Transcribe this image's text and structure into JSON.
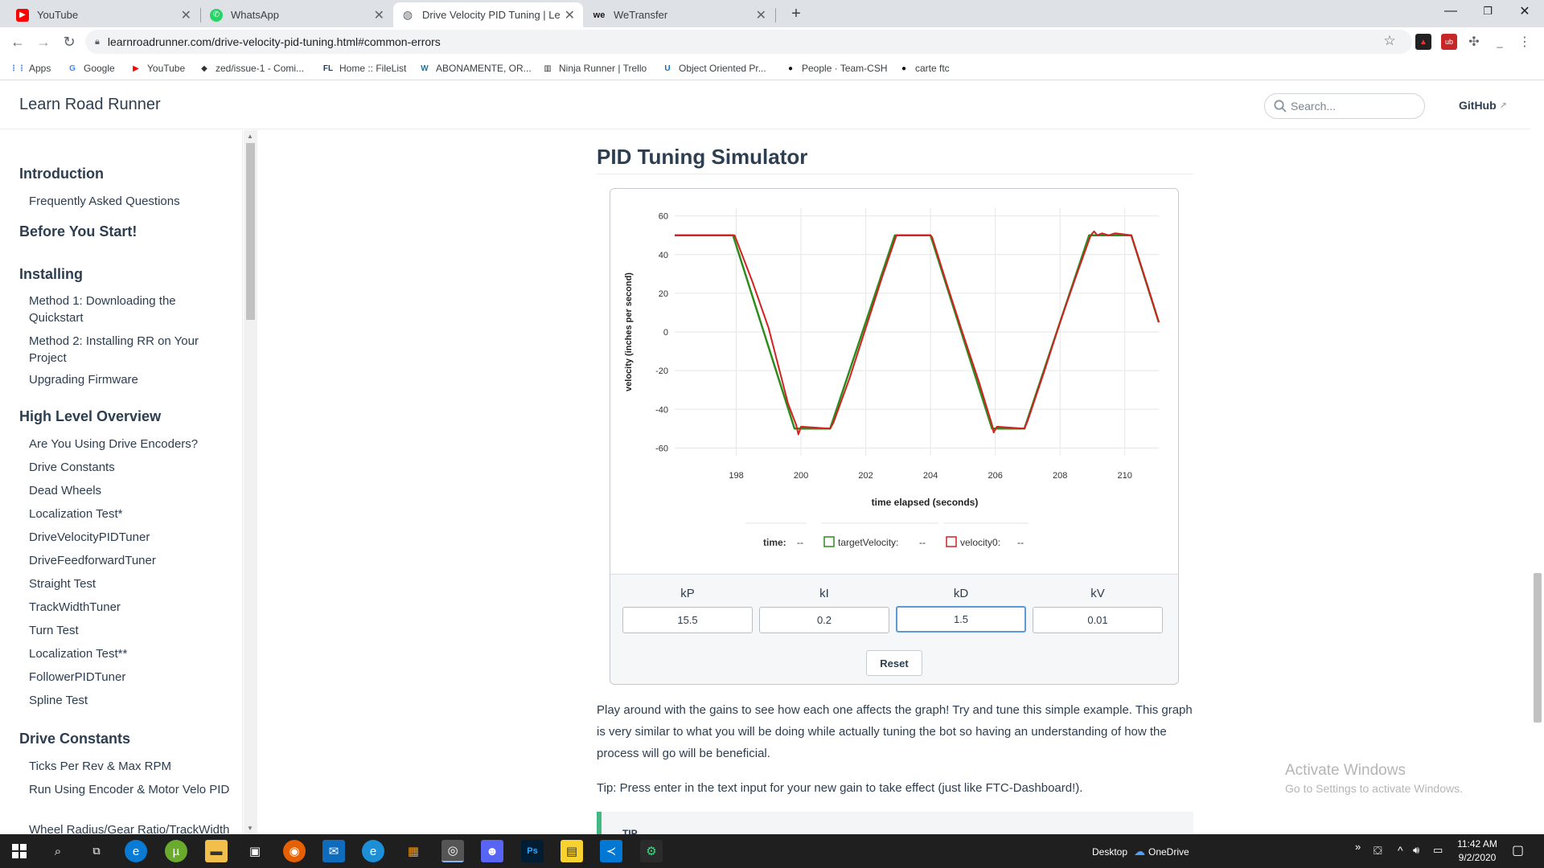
{
  "browser": {
    "tabs": [
      {
        "title": "YouTube",
        "icon": "youtube-icon",
        "color": "#ff0000",
        "glyph": "▶"
      },
      {
        "title": "WhatsApp",
        "icon": "whatsapp-icon",
        "color": "#25d366",
        "glyph": "✆"
      },
      {
        "title": "Drive Velocity PID Tuning | Learn",
        "icon": "globe-icon",
        "color": "#5f6368",
        "glyph": "◍"
      },
      {
        "title": "WeTransfer",
        "icon": "wetransfer-icon",
        "color": "#17181a",
        "glyph": "we"
      }
    ],
    "new_tab": "+",
    "close": "✕",
    "url": "learnroadrunner.com/drive-velocity-pid-tuning.html#common-errors",
    "bookmarks": [
      {
        "label": "Apps",
        "icon": "apps-grid-icon",
        "glyph": "⋮⋮",
        "color": "#4285f4"
      },
      {
        "label": "Google",
        "icon": "google-icon",
        "glyph": "G",
        "color": "#4285f4"
      },
      {
        "label": "YouTube",
        "icon": "youtube-icon",
        "glyph": "▶",
        "color": "#ff0000"
      },
      {
        "label": "zed/issue-1 - Comi...",
        "icon": "zed-icon",
        "glyph": "◆",
        "color": "#333333"
      },
      {
        "label": "Home :: FileList",
        "icon": "filelist-icon",
        "glyph": "FL",
        "color": "#1a3a6b"
      },
      {
        "label": "ABONAMENTE, OR...",
        "icon": "wordpress-icon",
        "glyph": "W",
        "color": "#21759b"
      },
      {
        "label": "Ninja Runner | Trello",
        "icon": "trello-icon",
        "glyph": "▥",
        "color": "#333333"
      },
      {
        "label": "Object Oriented Pr...",
        "icon": "udemy-icon",
        "glyph": "U",
        "color": "#0a6ebd"
      },
      {
        "label": "People · Team-CSH",
        "icon": "github-icon",
        "glyph": "●",
        "color": "#111111"
      },
      {
        "label": "carte ftc",
        "icon": "github-icon",
        "glyph": "●",
        "color": "#111111"
      }
    ]
  },
  "site": {
    "title": "Learn Road Runner",
    "search_placeholder": "Search...",
    "github": "GitHub"
  },
  "sidebar": {
    "groups": [
      {
        "title": "Introduction",
        "items": [
          "Frequently Asked Questions"
        ]
      },
      {
        "title": "Before You Start!",
        "items": []
      },
      {
        "title": "Installing",
        "items": [
          "Method 1: Downloading the Quickstart",
          "Method 2: Installing RR on Your Project",
          "Upgrading Firmware"
        ]
      },
      {
        "title": "High Level Overview",
        "items": [
          "Are You Using Drive Encoders?",
          "Drive Constants",
          "Dead Wheels",
          "Localization Test*",
          "DriveVelocityPIDTuner",
          "DriveFeedforwardTuner",
          "Straight Test",
          "TrackWidthTuner",
          "Turn Test",
          "Localization Test**",
          "FollowerPIDTuner",
          "Spline Test"
        ]
      },
      {
        "title": "Drive Constants",
        "items": [
          "Ticks Per Rev & Max RPM",
          "Run Using Encoder & Motor Velo PID",
          "Wheel Radius/Gear Ratio/TrackWidth"
        ]
      }
    ]
  },
  "main": {
    "heading": "PID Tuning Simulator",
    "gains": [
      {
        "label": "kP",
        "value": "15.5"
      },
      {
        "label": "kI",
        "value": "0.2"
      },
      {
        "label": "kD",
        "value": "1.5"
      },
      {
        "label": "kV",
        "value": "0.01"
      }
    ],
    "reset": "Reset",
    "para1": "Play around with the gains to see how each one affects the graph! Try and tune this simple example. This graph is very similar to what you will be doing while actually tuning the bot so having an understanding of how the process will go will be beneficial.",
    "para2": "Tip: Press enter in the text input for your new gain to take effect (just like FTC-Dashboard!).",
    "tip_label": "TIP"
  },
  "chart_data": {
    "type": "line",
    "xlabel": "time elapsed (seconds)",
    "ylabel": "velocity (inches per second)",
    "xlim": [
      196.1,
      211.05
    ],
    "ylim": [
      -64,
      64
    ],
    "xticks": [
      198,
      200,
      202,
      204,
      206,
      208,
      210
    ],
    "yticks": [
      60,
      40,
      20,
      0,
      -20,
      -40,
      -60
    ],
    "grid": true,
    "legend": {
      "time_label": "time:",
      "time_value": "--",
      "target_label": "targetVelocity:",
      "target_value": "--",
      "actual_label": "velocity0:",
      "actual_value": "--"
    },
    "series": [
      {
        "name": "targetVelocity",
        "color": "#2e8b1e",
        "x": [
          196.1,
          197.9,
          199.8,
          200.9,
          202.9,
          204.0,
          205.9,
          206.9,
          208.9,
          210.2,
          211.05
        ],
        "y": [
          50,
          50,
          -50,
          -50,
          50,
          50,
          -50,
          -50,
          50,
          50,
          5
        ]
      },
      {
        "name": "velocity0",
        "color": "#d42020",
        "x": [
          196.1,
          197.95,
          198.5,
          199.0,
          199.6,
          199.85,
          199.92,
          200.0,
          200.9,
          201.0,
          201.5,
          202.0,
          202.5,
          202.95,
          203.1,
          204.0,
          204.05,
          204.5,
          205.0,
          205.5,
          205.9,
          205.95,
          206.05,
          206.9,
          207.0,
          207.5,
          208.0,
          208.5,
          208.95,
          209.05,
          209.15,
          209.3,
          209.5,
          209.7,
          210.2,
          210.7,
          211.05
        ],
        "y": [
          50,
          50,
          26,
          2,
          -37,
          -48,
          -53,
          -49,
          -50,
          -47,
          -24,
          2,
          28,
          50,
          50,
          50,
          49,
          25,
          -1,
          -26,
          -48,
          -52,
          -49,
          -50,
          -46,
          -21,
          5,
          29,
          50,
          52,
          50,
          51,
          50,
          51,
          50,
          24,
          5
        ]
      }
    ]
  },
  "system": {
    "desktop": "Desktop",
    "onedrive": "OneDrive",
    "time": "11:42 AM",
    "date": "9/2/2020",
    "watermark_title": "Activate Windows",
    "watermark_sub": "Go to Settings to activate Windows."
  }
}
